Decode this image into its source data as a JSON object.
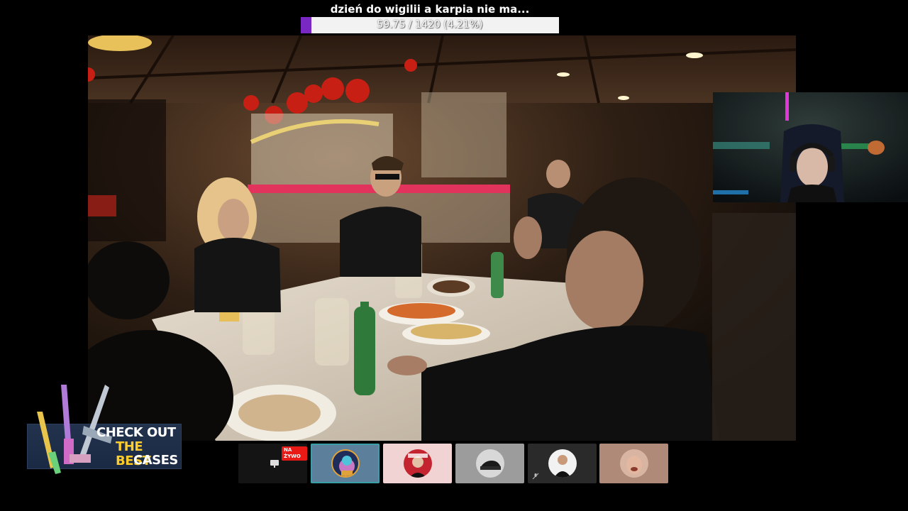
{
  "goal": {
    "title": "dzień do wigilii a karpia nie ma...",
    "progress_text": "59.75 / 1420 (4.21%)",
    "progress_fraction": 0.0421,
    "fill_color": "#7a28c4"
  },
  "main_video": {
    "content": "restaurant-dinner-scene"
  },
  "webcam": {
    "content": "streamer-webcam"
  },
  "promo": {
    "line1": "CHECK OUT",
    "line2": "THE BEST",
    "line3": "CASES",
    "accent_color": "#ffcc2a"
  },
  "participants": [
    {
      "id": "p1",
      "type": "screen-share",
      "live_label": "NA ŻYWO",
      "bg": "#141414",
      "icon": "screen-share-icon"
    },
    {
      "id": "p2",
      "type": "avatar",
      "bg": "#5c7f9c",
      "selected": true,
      "icon": "avatar"
    },
    {
      "id": "p3",
      "type": "avatar",
      "bg": "#f1d3d3",
      "icon": "avatar"
    },
    {
      "id": "p4",
      "type": "avatar",
      "bg": "#9c9c9c",
      "icon": "avatar"
    },
    {
      "id": "p5",
      "type": "avatar",
      "bg": "#2a2a2a",
      "muted": true,
      "icon": "mic-muted-icon"
    },
    {
      "id": "p6",
      "type": "avatar",
      "bg": "#b08a78",
      "icon": "avatar"
    }
  ]
}
